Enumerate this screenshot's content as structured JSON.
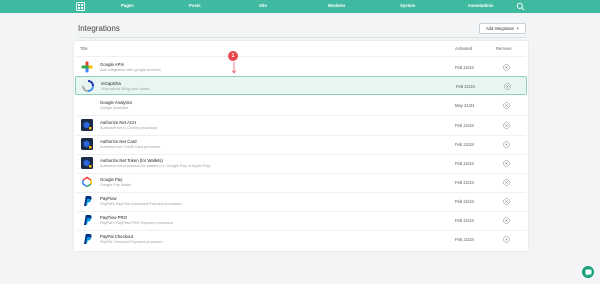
{
  "nav": {
    "items": [
      "Pages",
      "Posts",
      "Site",
      "Modules",
      "System",
      "monetadmin"
    ]
  },
  "page": {
    "title": "Integrations",
    "add_button": "Add Integration"
  },
  "table": {
    "headers": {
      "title": "Title",
      "activated": "Activated",
      "remove": "Remove"
    },
    "rows": [
      {
        "name": "Google APIs",
        "desc": "Add integration with google services",
        "date": "Feb 21/24",
        "icon": "google-apis-icon"
      },
      {
        "name": "reCaptcha",
        "desc": "Stop robots filling your forms",
        "date": "Feb 21/24",
        "icon": "recaptcha-icon"
      },
      {
        "name": "Google Analytics",
        "desc": "Google Analytics",
        "date": "May 21/24",
        "icon": "blank-icon"
      },
      {
        "name": "Authorize.Net ACH",
        "desc": "Authorize.net E-Checks processor",
        "date": "Feb 21/24",
        "icon": "authorize-net-icon"
      },
      {
        "name": "Authorize.Net Card",
        "desc": "Authorize.net Credit Card processor",
        "date": "Feb 21/24",
        "icon": "authorize-net-icon"
      },
      {
        "name": "Authorize.Net Token (for Wallets)",
        "desc": "Authorize.net processor for wallets (i.e. Google Pay or Apple Pay)",
        "date": "Feb 21/24",
        "icon": "authorize-net-icon"
      },
      {
        "name": "Google Pay",
        "desc": "Google Pay Wallet",
        "date": "Feb 21/24",
        "icon": "google-pay-icon"
      },
      {
        "name": "PayFlow",
        "desc": "PayPal's PayFlow Advanced Payment processor",
        "date": "Feb 21/24",
        "icon": "paypal-icon"
      },
      {
        "name": "PayFlow PRO",
        "desc": "PayPal's PayFlow PRO Payment processor",
        "date": "Feb 21/24",
        "icon": "paypal-icon"
      },
      {
        "name": "PayPal Checkout",
        "desc": "PayPal Checkout Payment processor",
        "date": "Feb 21/24",
        "icon": "paypal-icon"
      }
    ]
  },
  "annotation": {
    "badge": "1"
  },
  "colors": {
    "header": "#3fb99f",
    "highlight": "#e8f6f1",
    "badge": "#e5484d",
    "chat": "#1aa37a"
  }
}
